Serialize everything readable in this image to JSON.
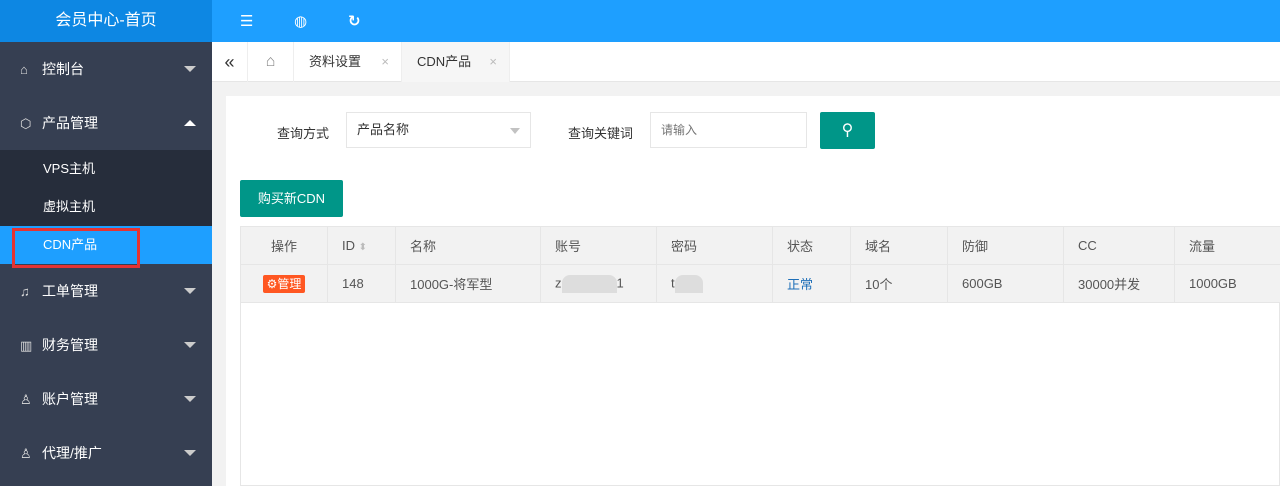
{
  "header": {
    "title": "会员中心-首页"
  },
  "sidebar": {
    "items": [
      {
        "label": "控制台",
        "icon": "home-icon"
      },
      {
        "label": "产品管理",
        "icon": "cube-icon",
        "sub": [
          "VPS主机",
          "虚拟主机",
          "CDN产品"
        ]
      },
      {
        "label": "工单管理",
        "icon": "bell-icon"
      },
      {
        "label": "财务管理",
        "icon": "finance-icon"
      },
      {
        "label": "账户管理",
        "icon": "user-icon"
      },
      {
        "label": "代理/推广",
        "icon": "user-icon"
      }
    ]
  },
  "tabs": [
    {
      "label": "资料设置"
    },
    {
      "label": "CDN产品"
    }
  ],
  "search": {
    "mode_label": "查询方式",
    "mode_value": "产品名称",
    "keyword_label": "查询关键词",
    "keyword_placeholder": "请输入"
  },
  "buy_button": "购买新CDN",
  "table": {
    "headers": [
      "操作",
      "ID",
      "名称",
      "账号",
      "密码",
      "状态",
      "域名",
      "防御",
      "CC",
      "流量"
    ],
    "rows": [
      {
        "action": "管理",
        "id": "148",
        "name": "1000G-将军型",
        "account_start": "z",
        "account_end": "1",
        "password_start": "t",
        "status": "正常",
        "domains": "10个",
        "defense": "600GB",
        "cc": "30000并发",
        "traffic": "1000GB"
      }
    ]
  },
  "colors": {
    "accent": "#1e9fff",
    "primary": "#009688",
    "danger": "#ff5722"
  }
}
